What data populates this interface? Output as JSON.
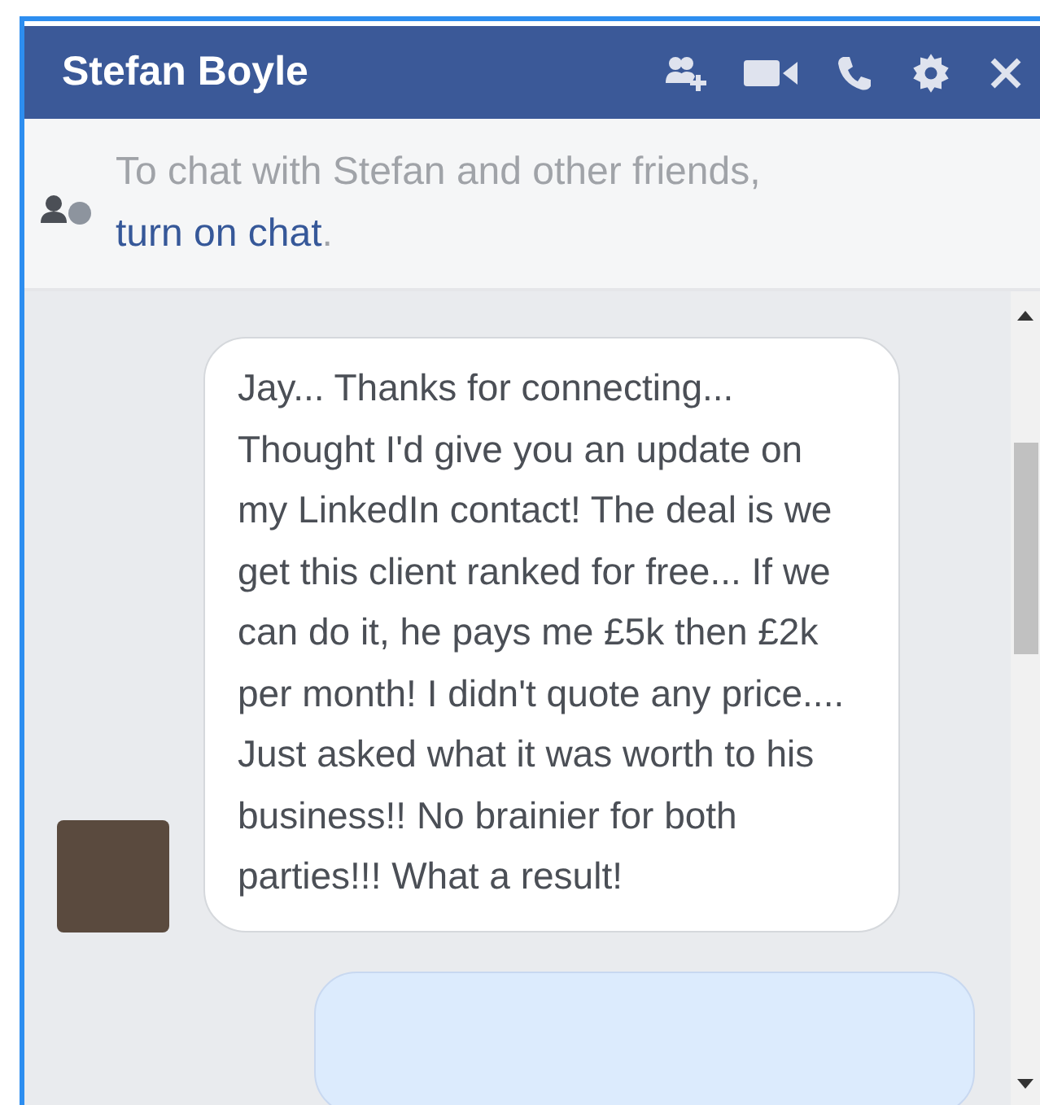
{
  "header": {
    "title": "Stefan Boyle"
  },
  "notice": {
    "text": "To chat with Stefan and other friends,",
    "link": "turn on chat",
    "after": "."
  },
  "messages": [
    {
      "kind": "received",
      "text": "Jay... Thanks for connecting... Thought I'd give you an update on my LinkedIn contact! The deal is we get this client ranked for free... If we can do it, he pays me £5k then £2k per month! I didn't quote any price.... Just asked what it was worth to his business!! No brainier for both parties!!! What a result!"
    },
    {
      "kind": "sent"
    }
  ]
}
